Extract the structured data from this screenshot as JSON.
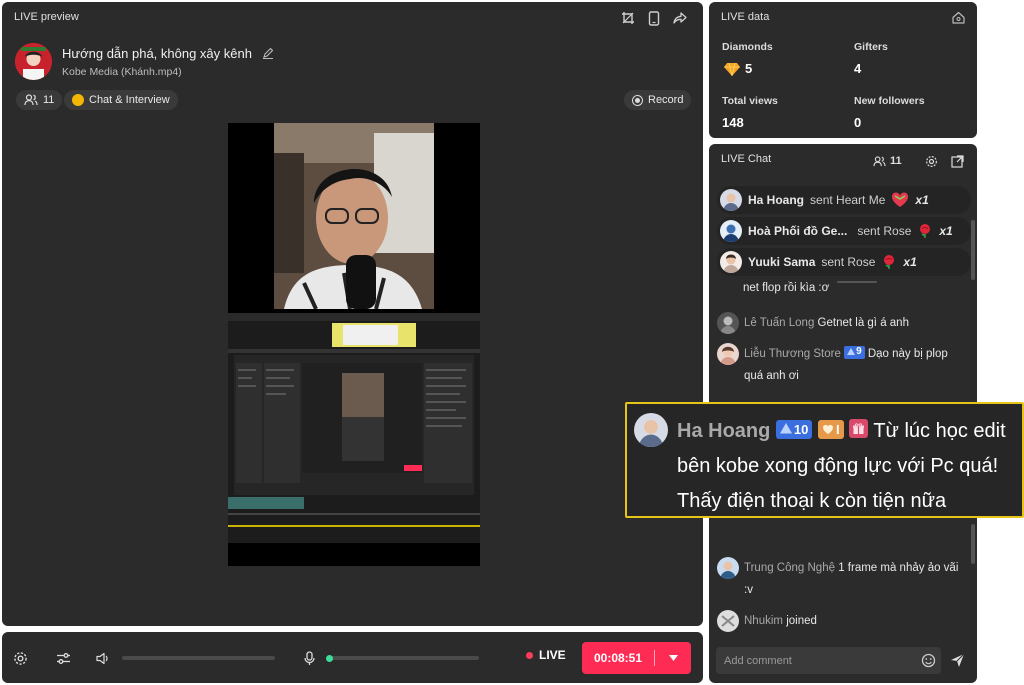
{
  "preview": {
    "title": "LIVE preview",
    "stream_title": "Hướng dẫn phá, không xây kênh",
    "source": "Kobe Media  (Khánh.mp4)",
    "viewer_count": "11",
    "topic": "Chat & Interview",
    "record_label": "Record"
  },
  "bottom": {
    "live_label": "LIVE",
    "timer": "00:08:51",
    "volume_level": 0.0,
    "mic_level": 0.03
  },
  "live_data": {
    "title": "LIVE data",
    "diamonds_label": "Diamonds",
    "diamonds_value": "5",
    "gifters_label": "Gifters",
    "gifters_value": "4",
    "views_label": "Total views",
    "views_value": "148",
    "followers_label": "New followers",
    "followers_value": "0"
  },
  "chat": {
    "title": "LIVE Chat",
    "viewer_count": "11",
    "gifts": [
      {
        "user": "Ha Hoang",
        "action": "sent Heart Me",
        "count": "x1"
      },
      {
        "user": "Hoà Phối đồ Ge...",
        "action": "sent Rose",
        "count": "x1"
      },
      {
        "user": "Yuuki Sama",
        "action": "sent Rose",
        "count": "x1"
      }
    ],
    "partial_line": "net flop rồi kìa :ơ",
    "messages": [
      {
        "user": "Lê Tuấn Long",
        "text": "Getnet là gì á anh"
      },
      {
        "user": "Liễu Thương Store",
        "badge": "9",
        "text": "Dạo này bị plop quá anh ơi"
      },
      {
        "user": "Trung Công Nghệ",
        "text": "1 frame mà nhảy ảo vãi :v"
      },
      {
        "user": "Nhukim",
        "text": "joined"
      }
    ],
    "comment_placeholder": "Add comment"
  },
  "highlight": {
    "user": "Ha Hoang",
    "level_badge": "10",
    "fan_badge": "I",
    "text": "Từ lúc học edit bên kobe xong động lực với Pc quá! Thấy điện thoại k còn tiện nữa"
  },
  "colors": {
    "panel": "#2b2b2b",
    "accent": "#fe2c55",
    "highlight_border": "#e6c51a",
    "level_badge": "#3b6fe0"
  }
}
